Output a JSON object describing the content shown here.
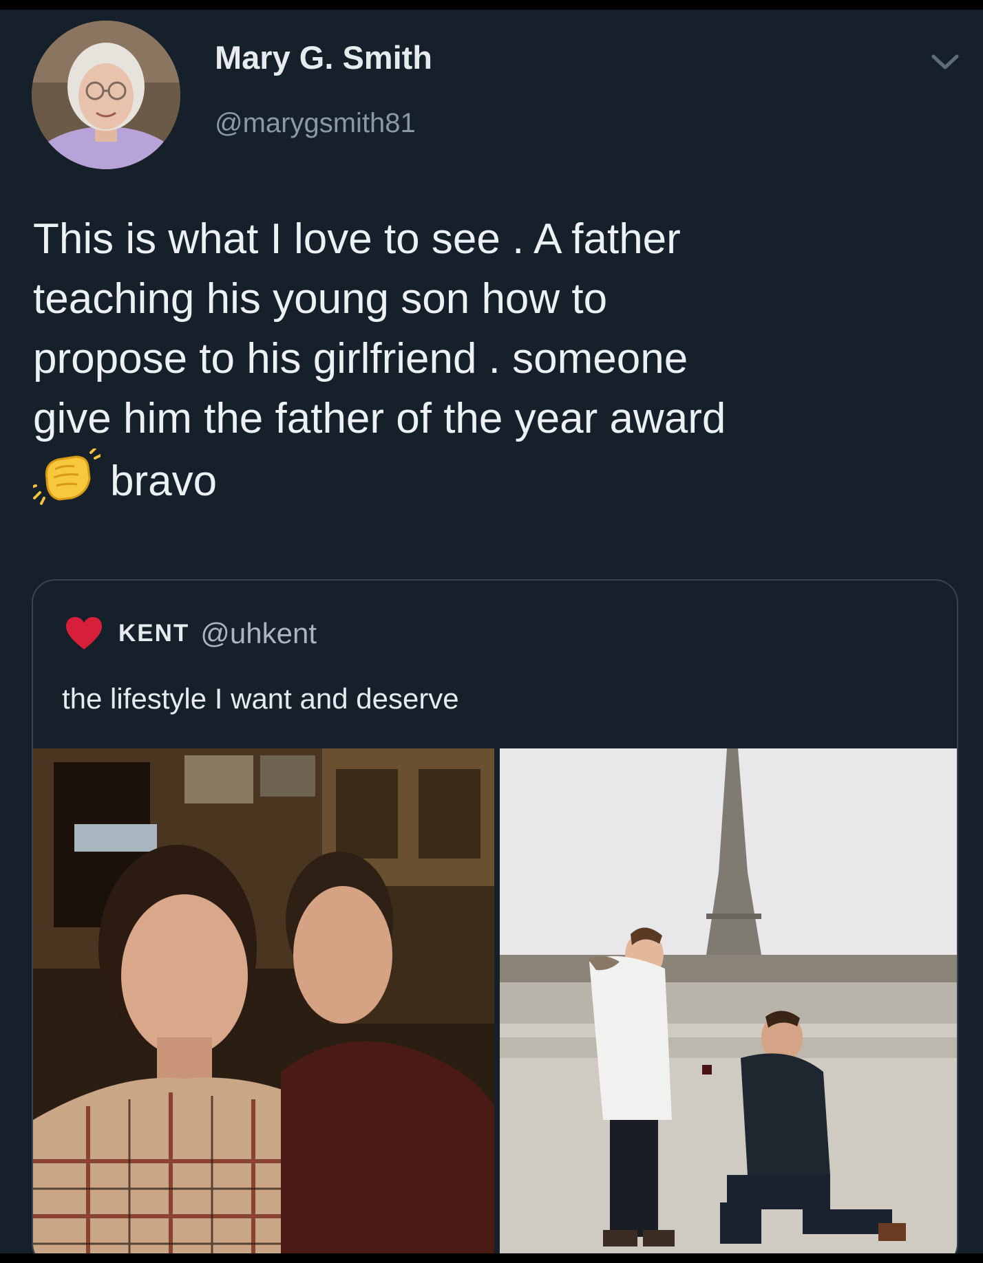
{
  "tweet": {
    "author_name": "Mary G. Smith",
    "author_handle": "@marygsmith81",
    "avatar_icon": "profile-photo-elderly-woman",
    "menu_icon": "chevron-down-icon",
    "text_lines": [
      "This is what I love to see . A father",
      "teaching his young son how to",
      "propose to his girlfriend . someone",
      "give him the father of the year award"
    ],
    "last_line_emoji": "clapping-hands-emoji",
    "last_line_text": "bravo"
  },
  "quoted_tweet": {
    "heart_icon": "red-heart-icon",
    "author_name": "KENT",
    "author_handle": "@uhkent",
    "text": "the lifestyle I want and deserve",
    "photos": [
      {
        "name": "restaurant-selfie-photo"
      },
      {
        "name": "eiffel-tower-proposal-photo"
      }
    ]
  },
  "colors": {
    "background": "#15202b",
    "border": "#38444d",
    "text_primary": "#e7ebee",
    "text_secondary": "#8b98a5",
    "heart": "#e0245e"
  }
}
